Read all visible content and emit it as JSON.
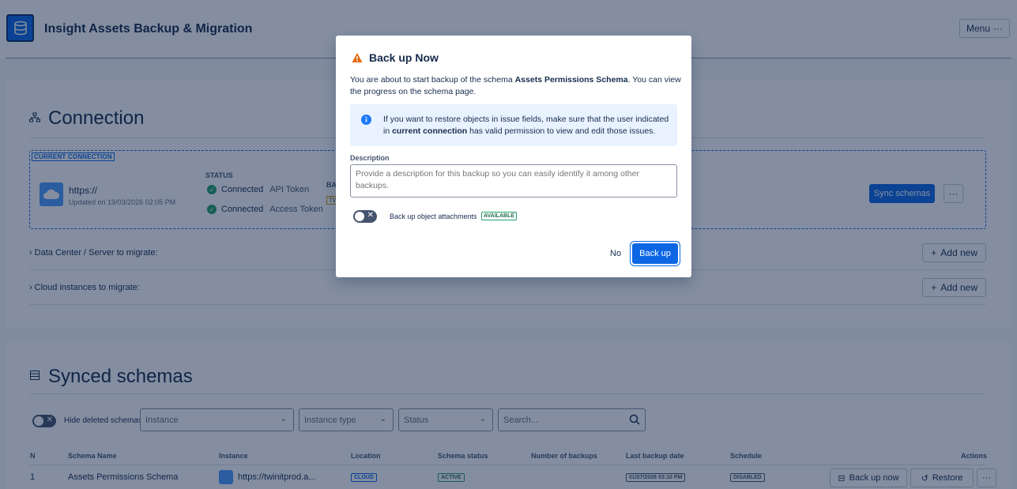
{
  "app": {
    "title": "Insight Assets Backup & Migration",
    "menu_label": "Menu"
  },
  "connection": {
    "title": "Connection",
    "current_tag": "CURRENT CONNECTION",
    "url": "https://",
    "updated": "Updated on 19/03/2026 02:05 PM",
    "status_header": "STATUS",
    "statuses": [
      {
        "state": "Connected",
        "type": "API Token"
      },
      {
        "state": "Connected",
        "type": "Access Token"
      }
    ],
    "ba_header": "BA",
    "tw_badge": "TW",
    "sync_label": "Sync schemas",
    "rows": [
      {
        "label": "Data Center / Server to migrate:",
        "add_label": "Add new"
      },
      {
        "label": "Cloud instances to migrate:",
        "add_label": "Add new"
      }
    ]
  },
  "schemas": {
    "title": "Synced schemas",
    "hide_deleted_label": "Hide deleted schemas",
    "filters": {
      "instance": "Instance",
      "instance_type": "Instance type",
      "status": "Status",
      "search_placeholder": "Search..."
    },
    "columns": [
      "N",
      "Schema Name",
      "Instance",
      "Location",
      "Schema status",
      "Number of backups",
      "Last backup date",
      "Schedule",
      "Actions"
    ],
    "rows": [
      {
        "n": "1",
        "name": "Assets Permissions Schema",
        "instance": "https://twinitprod.a...",
        "location": "CLOUD",
        "status": "ACTIVE",
        "backups": "",
        "last_backup": "01/07/2026 03:10 PM",
        "schedule": "DISABLED",
        "backup_label": "Back up now",
        "restore_label": "Restore"
      }
    ]
  },
  "modal": {
    "title": "Back up Now",
    "text_prefix": "You are about to start backup of the schema ",
    "schema_name": "Assets Permissions Schema",
    "text_suffix": ". You can view the progress on the schema page.",
    "info_prefix": "If you want to restore objects in issue fields, make sure that the user indicated in ",
    "info_bold": "current connection",
    "info_suffix": " has valid permission to view and edit those issues.",
    "desc_label": "Description",
    "desc_placeholder": "Provide a description for this backup so you can easily identify it among other backups.",
    "attachments_label": "Back up object attachments",
    "available_badge": "AVAILABLE",
    "no_label": "No",
    "backup_label": "Back up"
  },
  "colors": {
    "primary": "#0c66e4",
    "success": "#22a06b",
    "warning": "#e56910",
    "info": "#1d7afc"
  }
}
